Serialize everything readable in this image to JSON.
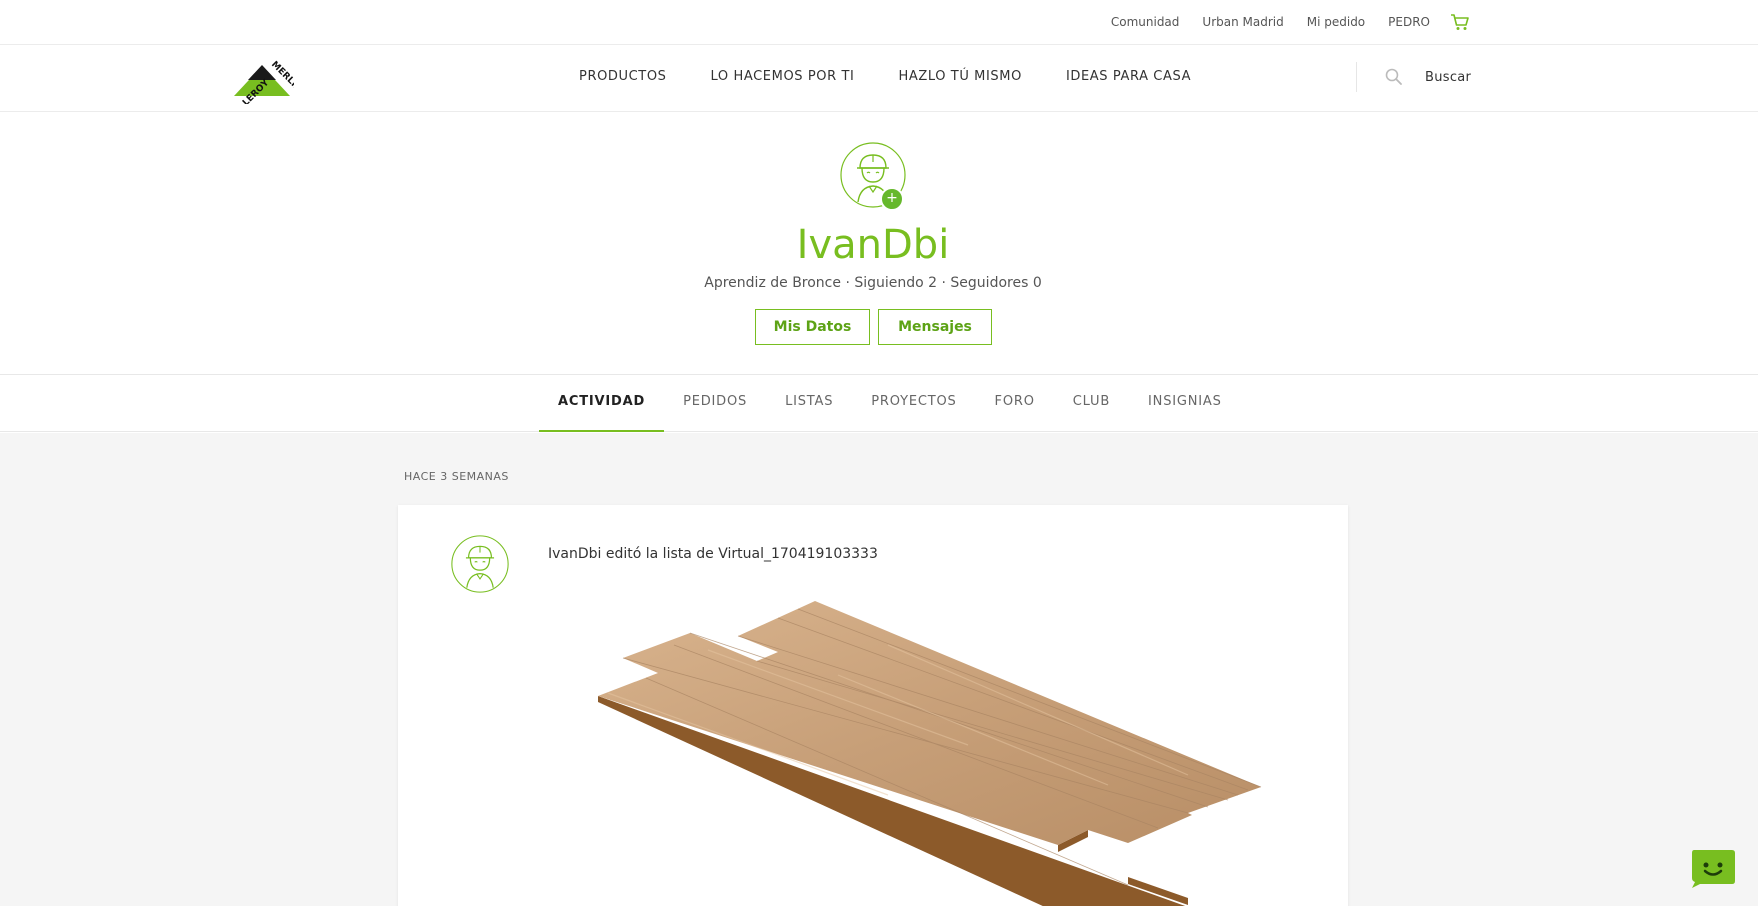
{
  "top_links": {
    "comunidad": "Comunidad",
    "store": "Urban Madrid",
    "pedido": "Mi pedido",
    "user": "PEDRO",
    "cart_icon": "cart-icon"
  },
  "brand": {
    "logo_text": "LEROY MERLIN",
    "color": "#78be20"
  },
  "nav": {
    "items": [
      "PRODUCTOS",
      "LO HACEMOS POR TI",
      "HAZLO TÚ MISMO",
      "IDEAS PARA CASA"
    ],
    "search_placeholder": "Buscar"
  },
  "profile": {
    "username": "IvanDbi",
    "level": "Aprendiz de Bronce",
    "stats_line": "Aprendiz de Bronce  · Siguiendo 2 · Seguidores 0",
    "buttons": {
      "mis_datos": "Mis Datos",
      "mensajes": "Mensajes"
    },
    "add_badge": "+"
  },
  "tabs": [
    "ACTIVIDAD",
    "PEDIDOS",
    "LISTAS",
    "PROYECTOS",
    "FORO",
    "CLUB",
    "INSIGNIAS"
  ],
  "active_tab": "ACTIVIDAD",
  "feed": {
    "timestamp": "HACE 3 SEMANAS",
    "activity": "IvanDbi editó la lista de Virtual_170419103333",
    "image_icon": "wood-flooring-planks"
  },
  "colors": {
    "accent": "#78be20",
    "background": "#f5f5f5"
  }
}
